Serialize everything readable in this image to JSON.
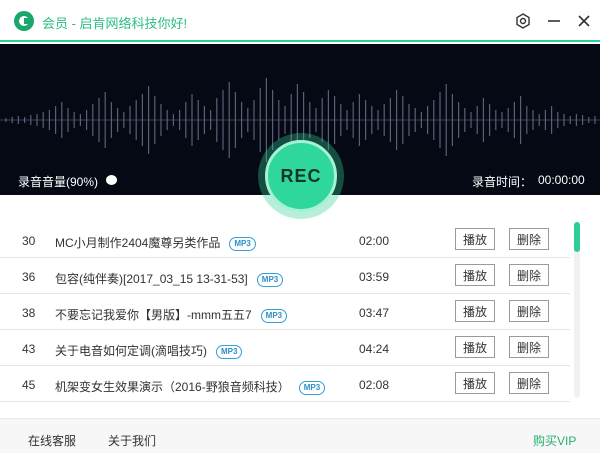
{
  "window": {
    "title": "会员 - 启肯网络科技你好!",
    "icons": [
      "app-logo-icon",
      "settings-gear-icon",
      "minimize-icon",
      "close-icon"
    ],
    "accent_color": "#2ecc9a"
  },
  "recorder": {
    "volume_label": "录音音量(90%)",
    "volume_percent": 90,
    "rec_label": "REC",
    "time_label": "录音时间：",
    "time_value": "00:00:00"
  },
  "list": {
    "items": [
      {
        "num": "30",
        "name": "MC小月制作2404魔尊另类作品",
        "format": "MP3",
        "duration": "02:00",
        "play": "播放",
        "delete": "删除"
      },
      {
        "num": "36",
        "name": "包容(纯伴奏)[2017_03_15 13-31-53]",
        "format": "MP3",
        "duration": "03:59",
        "play": "播放",
        "delete": "删除"
      },
      {
        "num": "38",
        "name": "不要忘记我爱你【男版】-mmm五五7",
        "format": "MP3",
        "duration": "03:47",
        "play": "播放",
        "delete": "删除"
      },
      {
        "num": "43",
        "name": "关于电音如何定调(滴唱技巧)",
        "format": "MP3",
        "duration": "04:24",
        "play": "播放",
        "delete": "删除"
      },
      {
        "num": "45",
        "name": "机架变女生效果演示（2016-野狼音频科技）",
        "format": "MP3",
        "duration": "02:08",
        "play": "播放",
        "delete": "删除"
      }
    ]
  },
  "footer": {
    "service": "在线客服",
    "about": "关于我们",
    "vip": "购买VIP"
  }
}
